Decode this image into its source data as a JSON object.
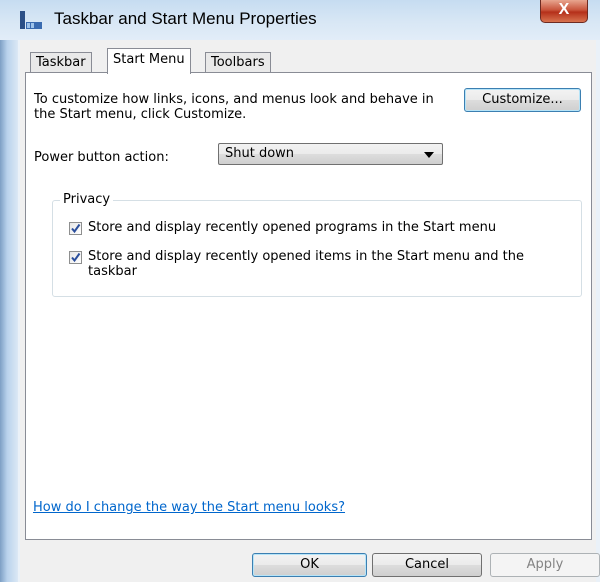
{
  "window": {
    "title": "Taskbar and Start Menu Properties",
    "close_label": "X"
  },
  "tabs": [
    {
      "label": "Taskbar",
      "active": false
    },
    {
      "label": "Start Menu",
      "active": true
    },
    {
      "label": "Toolbars",
      "active": false
    }
  ],
  "start_menu": {
    "intro_text": "To customize how links, icons, and menus look and behave in the Start menu, click Customize.",
    "customize_label": "Customize...",
    "power_label": "Power button action:",
    "power_value": "Shut down",
    "privacy_title": "Privacy",
    "checkboxes": [
      {
        "label": "Store and display recently opened programs in the Start menu",
        "checked": true
      },
      {
        "label": "Store and display recently opened items in the Start menu and the taskbar",
        "checked": true
      }
    ],
    "help_link": "How do I change the way the Start menu looks?"
  },
  "buttons": {
    "ok": "OK",
    "cancel": "Cancel",
    "apply": "Apply"
  },
  "colors": {
    "link": "#0066cc",
    "checkmark": "#2a4e9c"
  }
}
